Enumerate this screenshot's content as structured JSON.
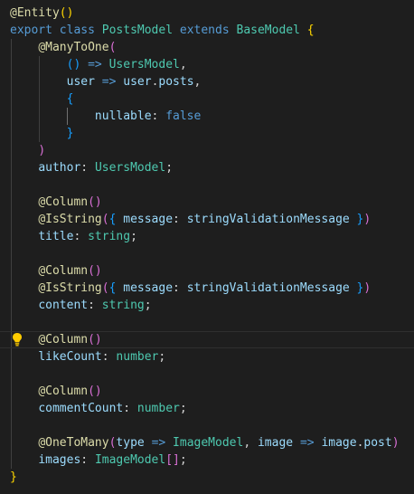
{
  "colors": {
    "background": "#1e1e1e",
    "decorator": "#dcdcaa",
    "keyword": "#569cd6",
    "type": "#4ec9b0",
    "variable": "#9cdcfe",
    "bracket_level1": "#ffd700",
    "bracket_level2": "#da70d6",
    "bracket_level3": "#179fff",
    "lightbulb": "#ffcc00"
  },
  "code": {
    "l1_decorator": "@Entity",
    "l1_paren": "()",
    "l2_export": "export",
    "l2_class": "class",
    "l2_classname": "PostsModel",
    "l2_extends": "extends",
    "l2_base": "BaseModel",
    "l2_brace": "{",
    "l3_decorator": "@ManyToOne",
    "l3_paren": "(",
    "l4_paren": "()",
    "l4_arrow": "=>",
    "l4_type": "UsersModel",
    "l4_comma": ",",
    "l5_param": "user",
    "l5_arrow": "=>",
    "l5_obj": "user",
    "l5_dot": ".",
    "l5_prop": "posts",
    "l5_comma": ",",
    "l6_brace": "{",
    "l7_key": "nullable",
    "l7_colon": ":",
    "l7_value": "false",
    "l8_brace": "}",
    "l9_paren": ")",
    "l10_prop": "author",
    "l10_colon": ":",
    "l10_type": "UsersModel",
    "l10_semi": ";",
    "l12_decorator": "@Column",
    "l12_paren": "()",
    "l13_decorator": "@IsString",
    "l13_open": "(",
    "l13_brace_open": "{",
    "l13_key": "message",
    "l13_colon": ":",
    "l13_value": "stringValidationMessage",
    "l13_brace_close": "}",
    "l13_close": ")",
    "l14_prop": "title",
    "l14_colon": ":",
    "l14_type": "string",
    "l14_semi": ";",
    "l16_decorator": "@Column",
    "l16_paren": "()",
    "l17_decorator": "@IsString",
    "l17_open": "(",
    "l17_brace_open": "{",
    "l17_key": "message",
    "l17_colon": ":",
    "l17_value": "stringValidationMessage",
    "l17_brace_close": "}",
    "l17_close": ")",
    "l18_prop": "content",
    "l18_colon": ":",
    "l18_type": "string",
    "l18_semi": ";",
    "l20_decorator": "@Column",
    "l20_paren": "()",
    "l21_prop": "likeCount",
    "l21_colon": ":",
    "l21_type": "number",
    "l21_semi": ";",
    "l23_decorator": "@Column",
    "l23_paren": "()",
    "l24_prop": "commentCount",
    "l24_colon": ":",
    "l24_type": "number",
    "l24_semi": ";",
    "l26_decorator": "@OneToMany",
    "l26_open": "(",
    "l26_param1": "type",
    "l26_arrow1": "=>",
    "l26_type": "ImageModel",
    "l26_comma": ",",
    "l26_param2": "image",
    "l26_arrow2": "=>",
    "l26_obj": "image",
    "l26_dot": ".",
    "l26_prop": "post",
    "l26_close": ")",
    "l27_prop": "images",
    "l27_colon": ":",
    "l27_type": "ImageModel",
    "l27_brackets": "[]",
    "l27_semi": ";",
    "l28_brace": "}"
  },
  "icons": {
    "lightbulb": "lightbulb-icon"
  }
}
